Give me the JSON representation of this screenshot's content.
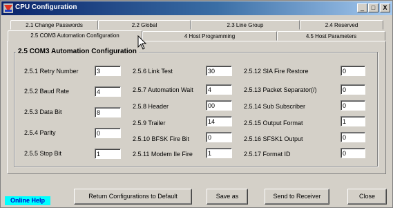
{
  "window": {
    "title": "CPU Configuration",
    "minimize": "_",
    "restore": "□",
    "close": "X"
  },
  "tabs_row1": [
    "2.1 Change Passwords",
    "2.2 Global",
    "2.3 Line Group",
    "2.4 Reserved"
  ],
  "tabs_row2": [
    "2.5 COM3 Automation Configuration",
    "4 Host Programming",
    "4.5  Host Parameters"
  ],
  "group_title": "2.5 COM3 Automation Configuration",
  "fields": [
    {
      "label": "2.5.1 Retry Number",
      "value": "3"
    },
    {
      "label": "2.5.2 Baud Rate",
      "value": "4"
    },
    {
      "label": "2.5.3 Data Bit",
      "value": "8"
    },
    {
      "label": "2.5.4 Parity",
      "value": "0"
    },
    {
      "label": "2.5.5 Stop Bit",
      "value": "1"
    },
    {
      "label": "2.5.6 Link Test",
      "value": "30"
    },
    {
      "label": "2.5.7 Automation Wait",
      "value": "4"
    },
    {
      "label": "2.5.8 Header",
      "value": "00"
    },
    {
      "label": "2.5.9 Trailer",
      "value": "14"
    },
    {
      "label": "2.5.10 BFSK Fire Bit",
      "value": "0"
    },
    {
      "label": "2.5.11 Modem Ile Fire",
      "value": "1"
    },
    {
      "label": "2.5.12 SIA Fire Restore",
      "value": "0"
    },
    {
      "label": "2.5.13 Packet Separator(/)",
      "value": "0"
    },
    {
      "label": "2.5.14 Sub Subscriber",
      "value": "0"
    },
    {
      "label": "2.5.15 Output Format",
      "value": "1"
    },
    {
      "label": "2.5.16  SFSK1 Output",
      "value": "0"
    },
    {
      "label": "2.5.17 Format ID",
      "value": "0"
    }
  ],
  "buttons": {
    "online_help": "Online Help",
    "return_default": "Return Configurations to Default",
    "save_as": "Save as",
    "send_receiver": "Send to Receiver",
    "close": "Close"
  },
  "colors": {
    "title_start": "#0a246a",
    "title_end": "#a6caf0",
    "online_help_bg": "#00ffff"
  }
}
